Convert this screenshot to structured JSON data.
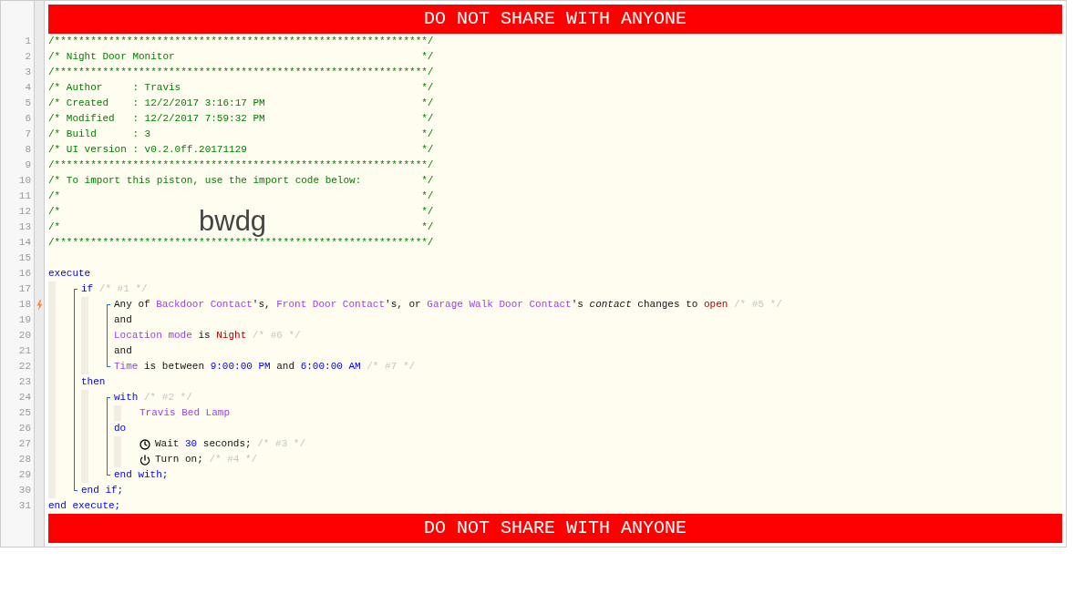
{
  "top_banner": "DO NOT SHARE WITH ANYONE",
  "line_numbers": [
    {
      "number": "1",
      "trigger": false
    },
    {
      "number": "2",
      "trigger": false
    },
    {
      "number": "3",
      "trigger": false
    },
    {
      "number": "4",
      "trigger": false
    },
    {
      "number": "5",
      "trigger": false
    },
    {
      "number": "6",
      "trigger": false
    },
    {
      "number": "7",
      "trigger": false
    },
    {
      "number": "8",
      "trigger": false
    },
    {
      "number": "9",
      "trigger": false
    },
    {
      "number": "10",
      "trigger": false
    },
    {
      "number": "11",
      "trigger": false
    },
    {
      "number": "12",
      "trigger": false
    },
    {
      "number": "13",
      "trigger": false
    },
    {
      "number": "14",
      "trigger": false
    },
    {
      "number": "15",
      "trigger": false
    },
    {
      "number": "16",
      "trigger": false
    },
    {
      "number": "17",
      "trigger": false
    },
    {
      "number": "18",
      "trigger": true
    },
    {
      "number": "19",
      "trigger": false
    },
    {
      "number": "20",
      "trigger": false
    },
    {
      "number": "21",
      "trigger": false
    },
    {
      "number": "22",
      "trigger": false
    },
    {
      "number": "23",
      "trigger": false
    },
    {
      "number": "24",
      "trigger": false
    },
    {
      "number": "25",
      "trigger": false
    },
    {
      "number": "26",
      "trigger": false
    },
    {
      "number": "27",
      "trigger": false
    },
    {
      "number": "28",
      "trigger": false
    },
    {
      "number": "29",
      "trigger": false
    },
    {
      "number": "30",
      "trigger": false
    },
    {
      "number": "31",
      "trigger": false
    }
  ],
  "code": [
    {
      "kind": "header",
      "text": "/**************************************************************/"
    },
    {
      "kind": "header",
      "text": "/* Night Door Monitor",
      "end": "*/"
    },
    {
      "kind": "header",
      "text": "/**************************************************************/"
    },
    {
      "kind": "header",
      "text": "/* Author     : Travis",
      "end": "*/"
    },
    {
      "kind": "header",
      "text": "/* Created    : 12/2/2017 3:16:17 PM",
      "end": "*/"
    },
    {
      "kind": "header",
      "text": "/* Modified   : 12/2/2017 7:59:32 PM",
      "end": "*/"
    },
    {
      "kind": "header",
      "text": "/* Build      : 3",
      "end": "*/"
    },
    {
      "kind": "header",
      "text": "/* UI version : v0.2.0ff.20171129",
      "end": "*/"
    },
    {
      "kind": "header",
      "text": "/**************************************************************/"
    },
    {
      "kind": "header",
      "text": "/* To import this piston, use the import code below:",
      "end": "*/"
    },
    {
      "kind": "header",
      "text": "/*",
      "end": "*/"
    },
    {
      "kind": "header",
      "text": "/*",
      "end": "*/"
    },
    {
      "kind": "header",
      "text": "/*",
      "end": "*/"
    },
    {
      "kind": "header",
      "text": "/**************************************************************/"
    },
    {
      "kind": "line"
    },
    {
      "kind": "line",
      "tokens": [
        {
          "kind": "keyword",
          "text": "execute"
        }
      ]
    },
    {
      "kind": "block",
      "children": [
        {
          "kind": "group",
          "children": [
            {
              "kind": "line",
              "tokens": [
                {
                  "kind": "keyword",
                  "text": "if"
                },
                {
                  "kind": "comment",
                  "text": " /* #1 */"
                }
              ]
            },
            {
              "kind": "block",
              "children": [
                {
                  "kind": "group",
                  "children": [
                    {
                      "kind": "line",
                      "tokens": [
                        {
                          "kind": "plain",
                          "text": "Any of "
                        },
                        {
                          "kind": "device",
                          "text": "Backdoor Contact"
                        },
                        {
                          "kind": "plain",
                          "text": "'s, "
                        },
                        {
                          "kind": "device",
                          "text": "Front Door Contact"
                        },
                        {
                          "kind": "plain",
                          "text": "'s, or "
                        },
                        {
                          "kind": "device",
                          "text": "Garage Walk Door Contact"
                        },
                        {
                          "kind": "plain",
                          "text": "'s "
                        },
                        {
                          "kind": "italic",
                          "text": "contact"
                        },
                        {
                          "kind": "plain",
                          "text": " changes to "
                        },
                        {
                          "kind": "value",
                          "text": "open"
                        },
                        {
                          "kind": "comment",
                          "text": " /* #5 */"
                        }
                      ]
                    },
                    {
                      "kind": "line",
                      "tokens": [
                        {
                          "kind": "plain",
                          "text": "and"
                        }
                      ]
                    },
                    {
                      "kind": "line",
                      "tokens": [
                        {
                          "kind": "device",
                          "text": "Location mode"
                        },
                        {
                          "kind": "plain",
                          "text": " is "
                        },
                        {
                          "kind": "value",
                          "text": "Night"
                        },
                        {
                          "kind": "comment",
                          "text": " /* #6 */"
                        }
                      ]
                    },
                    {
                      "kind": "line",
                      "tokens": [
                        {
                          "kind": "plain",
                          "text": "and"
                        }
                      ]
                    },
                    {
                      "kind": "line",
                      "tokens": [
                        {
                          "kind": "device",
                          "text": "Time"
                        },
                        {
                          "kind": "plain",
                          "text": " is between "
                        },
                        {
                          "kind": "number",
                          "text": "9:00:00 PM"
                        },
                        {
                          "kind": "plain",
                          "text": " and "
                        },
                        {
                          "kind": "number",
                          "text": "6:00:00 AM"
                        },
                        {
                          "kind": "comment",
                          "text": " /* #7 */"
                        }
                      ]
                    }
                  ]
                }
              ]
            },
            {
              "kind": "line",
              "tokens": [
                {
                  "kind": "keyword",
                  "text": "then"
                }
              ]
            },
            {
              "kind": "block",
              "children": [
                {
                  "kind": "group",
                  "children": [
                    {
                      "kind": "line",
                      "tokens": [
                        {
                          "kind": "keyword",
                          "text": "with"
                        },
                        {
                          "kind": "comment",
                          "text": " /* #2 */"
                        }
                      ]
                    },
                    {
                      "kind": "block",
                      "children": [
                        {
                          "kind": "line",
                          "tokens": [
                            {
                              "kind": "device",
                              "text": "Travis Bed Lamp"
                            }
                          ]
                        }
                      ]
                    },
                    {
                      "kind": "line",
                      "tokens": [
                        {
                          "kind": "keyword",
                          "text": "do"
                        }
                      ]
                    },
                    {
                      "kind": "block",
                      "children": [
                        {
                          "kind": "wait_action",
                          "tokens": [
                            {
                              "kind": "plain",
                              "text": "Wait "
                            },
                            {
                              "kind": "number",
                              "text": "30"
                            },
                            {
                              "kind": "plain",
                              "text": " seconds;"
                            },
                            {
                              "kind": "comment",
                              "text": " /* #3 */"
                            }
                          ]
                        },
                        {
                          "kind": "switch_action",
                          "tokens": [
                            {
                              "kind": "plain",
                              "text": "Turn on;"
                            },
                            {
                              "kind": "comment",
                              "text": " /* #4 */"
                            }
                          ]
                        }
                      ]
                    },
                    {
                      "kind": "line",
                      "tokens": [
                        {
                          "kind": "keyword",
                          "text": "end with;"
                        }
                      ]
                    }
                  ]
                }
              ]
            },
            {
              "kind": "line",
              "tokens": [
                {
                  "kind": "keyword",
                  "text": "end if;"
                }
              ]
            }
          ]
        }
      ]
    },
    {
      "kind": "line",
      "tokens": [
        {
          "kind": "keyword",
          "text": "end execute;"
        }
      ]
    }
  ],
  "import_code": "bwdg",
  "bottom_banner": "DO NOT SHARE WITH ANYONE"
}
